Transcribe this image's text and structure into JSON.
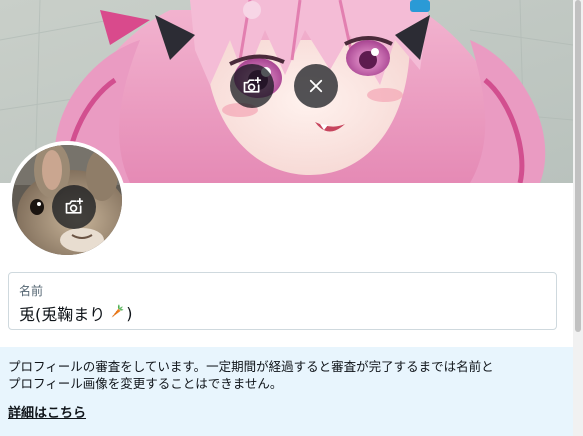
{
  "banner": {
    "change_photo_icon": "camera-plus-icon",
    "remove_icon": "close-icon"
  },
  "avatar": {
    "change_photo_icon": "camera-plus-icon"
  },
  "name_field": {
    "label": "名前",
    "value_text": "兎(兎鞠まり",
    "value_emoji_icon": "carrot-icon",
    "value_suffix": ")"
  },
  "notice": {
    "line1": "プロフィールの審査をしています。一定期間が経過すると審査が完了するまでは名前と",
    "line2": "プロフィール画像を変更することはできません。",
    "link_label": "詳細はこちら",
    "background": "#e8f5fd"
  },
  "colors": {
    "overlay_button": "#0f1419",
    "field_border": "#cfd9de",
    "label_text": "#536471"
  }
}
